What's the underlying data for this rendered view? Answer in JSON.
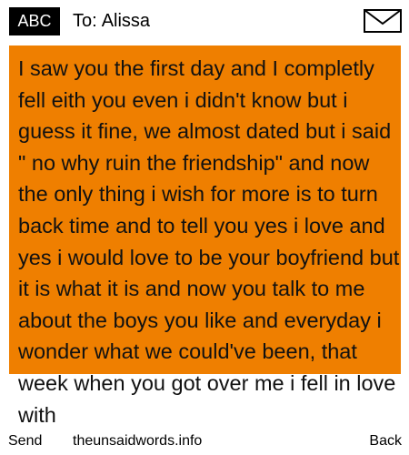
{
  "header": {
    "input_mode": "ABC",
    "to_label": "To:",
    "recipient": "Alissa",
    "icon": "envelope-icon"
  },
  "message": {
    "text": "I saw you the first day and I completly fell eith you even i didn't know but i guess it fine, we almost dated but i said \" no why ruin the friendship\" and now the only thing i wish for more is to turn back time and to tell you yes i love and yes i would love to be your boyfriend but it is what it is and now you talk to me about the boys you like and everyday i wonder what we could've been, that week when you got over me i fell in love with"
  },
  "footer": {
    "send_label": "Send",
    "watermark": "theunsaidwords.info",
    "back_label": "Back"
  },
  "colors": {
    "message_panel": "#ef7f00",
    "badge": "#000000",
    "background": "#ffffff"
  }
}
